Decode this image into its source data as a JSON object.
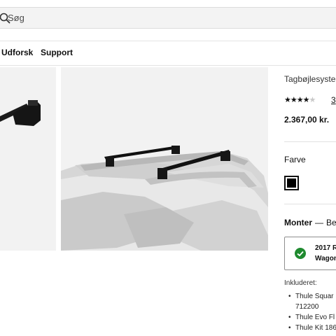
{
  "search": {
    "placeholder": "Søg"
  },
  "nav": {
    "items": [
      "Udforsk",
      "Support"
    ]
  },
  "product": {
    "title": "Tagbøjlesyste",
    "rating_stars": 3.5,
    "rating_count": "3",
    "price": "2.367,00 kr."
  },
  "color": {
    "label": "Farve",
    "selected_hex": "#000000"
  },
  "mount": {
    "label": "Monter",
    "dash": "—",
    "value": "Be"
  },
  "fit": {
    "line1": "2017 R",
    "line2": "Wagon"
  },
  "included": {
    "label": "Inkluderet:",
    "items": [
      "Thule Squar",
      "712200",
      "Thule Evo Fl",
      "Thule Kit 186"
    ]
  },
  "colors": {
    "accent_check": "#1f8a2f",
    "nav_border": "#e4e4e4",
    "search_bg": "#f3f3f3"
  }
}
